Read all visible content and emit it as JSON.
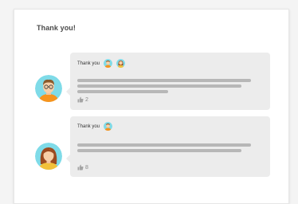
{
  "card": {
    "title": "Thank you!"
  },
  "comments": [
    {
      "author": "man-glasses",
      "label": "Thank you",
      "likes": "2",
      "mentioned": [
        "man-avatar",
        "woman-avatar"
      ]
    },
    {
      "author": "woman-brown-hair",
      "label": "Thank you",
      "likes": "8",
      "mentioned": [
        "man-avatar"
      ]
    }
  ],
  "colors": {
    "avatar_bg": "#7fdbe8",
    "bubble_bg": "#ececec",
    "line": "#b7b7b7",
    "card_bg": "#ffffff"
  }
}
